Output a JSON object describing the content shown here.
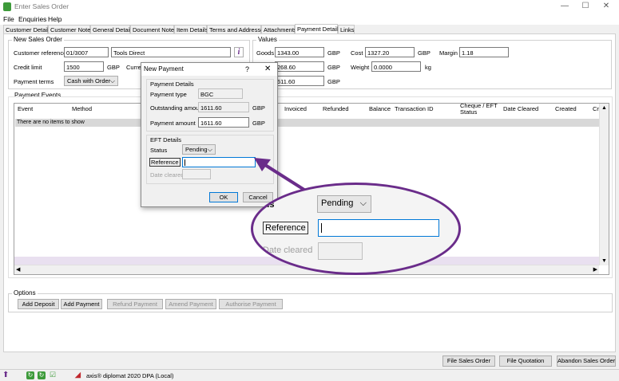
{
  "window": {
    "title": "Enter Sales Order",
    "minimize": "—",
    "maximize": "☐",
    "close": "✕"
  },
  "menu": [
    "File",
    "Enquiries",
    "Help"
  ],
  "tabs": [
    "Customer Details",
    "Customer Notes",
    "General Details",
    "Document Notes",
    "Item Details",
    "Terms and Addresses",
    "Attachments",
    "Payment Details",
    "Links"
  ],
  "active_tab": "Payment Details",
  "new_sales_order": {
    "label": "New Sales Order",
    "customer_reference_label": "Customer reference",
    "customer_reference": "01/3007",
    "customer_name": "Tools Direct",
    "credit_limit_label": "Credit limit",
    "credit_limit": "1500",
    "currency": "GBP",
    "current_label": "Current",
    "payment_terms_label": "Payment terms",
    "payment_terms": "Cash with Order"
  },
  "values": {
    "label": "Values",
    "goods_label": "Goods",
    "goods": "1343.00",
    "goods_currency": "GBP",
    "cost_label": "Cost",
    "cost": "1327.20",
    "cost_currency": "GBP",
    "margin_label": "Margin",
    "margin": "1.18",
    "vat_partial": "268.60",
    "vat_currency": "GBP",
    "weight_label": "Weight",
    "weight": "0.0000",
    "weight_unit": "kg",
    "total_partial": "611.60",
    "total_currency": "GBP"
  },
  "payment_events": {
    "label": "Payment Events",
    "columns": [
      "Event",
      "Method",
      "Invoiced",
      "Refunded",
      "Balance",
      "Transaction ID",
      "Cheque / EFT Status",
      "Date Cleared",
      "Created",
      "Cre"
    ],
    "empty_text": "There are no items to show"
  },
  "options": {
    "label": "Options",
    "add_deposit": "Add Deposit",
    "add_payment": "Add Payment",
    "refund_payment": "Refund Payment",
    "amend_payment": "Amend Payment",
    "authorise_payment": "Authorise Payment"
  },
  "footer": {
    "file_sales_order": "File Sales Order",
    "file_quotation": "File Quotation",
    "abandon_sales_order": "Abandon Sales Order"
  },
  "statusbar": {
    "product": "axis® diplomat 2020",
    "dpa": "DPA (Local)"
  },
  "dialog": {
    "title": "New Payment",
    "help": "?",
    "close": "✕",
    "payment_details_label": "Payment Details",
    "payment_type_label": "Payment type",
    "payment_type": "BGC",
    "outstanding_amount_label": "Outstanding amount",
    "outstanding_amount": "1611.60",
    "payment_amount_label": "Payment amount",
    "payment_amount": "1611.60",
    "currency": "GBP",
    "eft_details_label": "EFT Details",
    "status_label": "Status",
    "status": "Pending",
    "reference_label": "Reference",
    "reference": "",
    "date_cleared_label": "Date cleared",
    "ok": "OK",
    "cancel": "Cancel"
  },
  "zoom": {
    "status_partial": "tus",
    "status": "Pending",
    "reference_label": "Reference",
    "date_cleared_label": "Date cleared"
  },
  "colors": {
    "accent": "#6a2c8a",
    "selected_row": "#d8d8d8",
    "purple_bar": "#e9e0f0"
  }
}
